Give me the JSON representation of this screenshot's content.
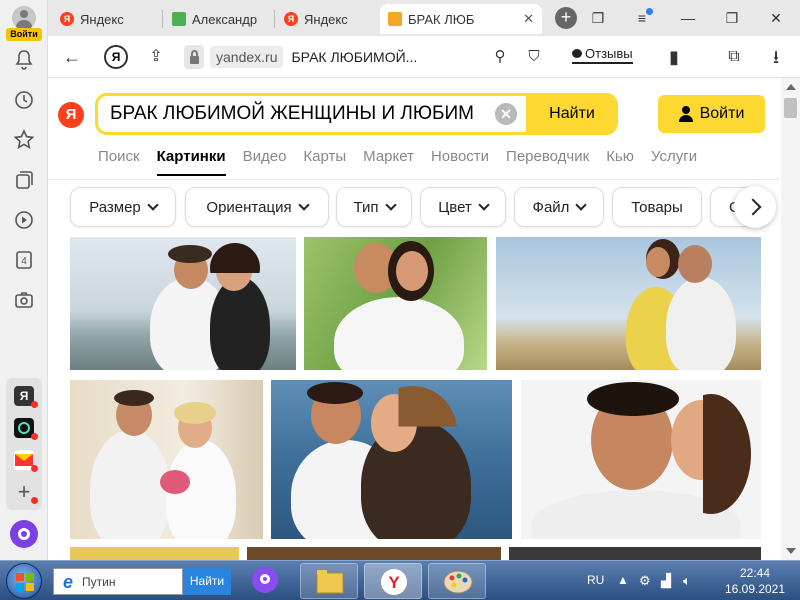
{
  "sidebar": {
    "login_label": "Войти",
    "items": [
      "bell-icon",
      "history-icon",
      "star-icon",
      "collections-icon",
      "video-icon",
      "tabs-counter-icon",
      "screenshot-icon"
    ],
    "tabs_counter": "4",
    "dock": [
      "yandex-app",
      "camera-app",
      "mail-app",
      "add-app"
    ]
  },
  "tabs": [
    {
      "label": "Яндекс",
      "favicon": "yandex-icon"
    },
    {
      "label": "Александр",
      "favicon": "green-square-icon"
    },
    {
      "label": "Яндекс",
      "favicon": "yandex-icon"
    },
    {
      "label": "БРАК ЛЮБ",
      "favicon": "image-icon",
      "active": true
    }
  ],
  "addressbar": {
    "domain": "yandex.ru",
    "page_title": "БРАК ЛЮБИМОЙ...",
    "reviews_label": "Отзывы"
  },
  "search": {
    "query": "БРАК ЛЮБИМОЙ ЖЕНЩИНЫ И ЛЮБИМ",
    "submit_label": "Найти",
    "login_label": "Войти"
  },
  "services": [
    "Поиск",
    "Картинки",
    "Видео",
    "Карты",
    "Маркет",
    "Новости",
    "Переводчик",
    "Кью",
    "Услуги"
  ],
  "active_service": "Картинки",
  "filters": [
    {
      "label": "Размер",
      "dropdown": true
    },
    {
      "label": "Ориентация",
      "dropdown": true
    },
    {
      "label": "Тип",
      "dropdown": true
    },
    {
      "label": "Цвет",
      "dropdown": true
    },
    {
      "label": "Файл",
      "dropdown": true
    },
    {
      "label": "Товары",
      "dropdown": false
    },
    {
      "label": "С",
      "dropdown": false
    }
  ],
  "images": [
    {
      "desc": "couple-embracing-by-river"
    },
    {
      "desc": "couple-smiling-in-park"
    },
    {
      "desc": "couple-in-meadow"
    },
    {
      "desc": "couple-wedding-bouquet"
    },
    {
      "desc": "couple-by-sea"
    },
    {
      "desc": "couple-kissing-cheek"
    }
  ],
  "taskbar": {
    "search_placeholder": "Путин",
    "search_button": "Найти",
    "lang": "RU",
    "time": "22:44",
    "date": "16.09.2021"
  },
  "colors": {
    "yandex_yellow": "#fdd831",
    "yandex_red": "#fc3f1d",
    "taskbar": "#2c4f82"
  }
}
